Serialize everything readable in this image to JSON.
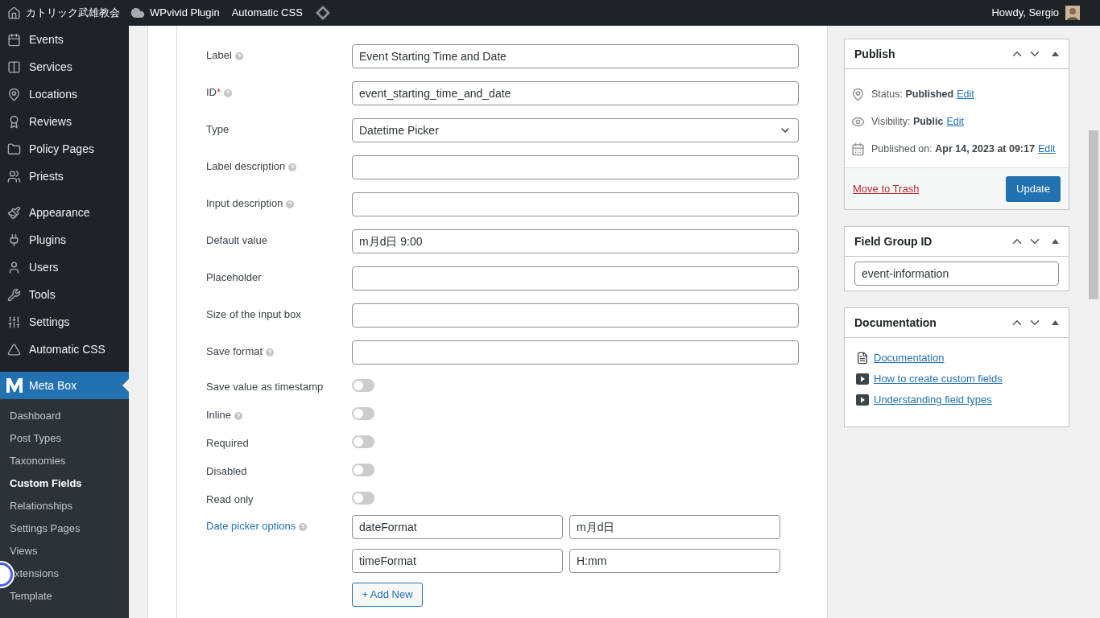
{
  "admin_bar": {
    "site_name": "カトリック武雄教会",
    "items": [
      "WPvivid Plugin",
      "Automatic CSS"
    ],
    "greeting": "Howdy, Sergio"
  },
  "sidebar": {
    "items": [
      {
        "label": "Events",
        "selected": false
      },
      {
        "label": "Services",
        "selected": false
      },
      {
        "label": "Locations",
        "selected": false
      },
      {
        "label": "Reviews",
        "selected": false
      },
      {
        "label": "Policy Pages",
        "selected": false
      },
      {
        "label": "Priests",
        "selected": false
      },
      {
        "label": "Appearance",
        "selected": false
      },
      {
        "label": "Plugins",
        "selected": false
      },
      {
        "label": "Users",
        "selected": false
      },
      {
        "label": "Tools",
        "selected": false
      },
      {
        "label": "Settings",
        "selected": false
      },
      {
        "label": "Automatic CSS",
        "selected": false
      },
      {
        "label": "Meta Box",
        "selected": true
      }
    ],
    "submenu": [
      {
        "label": "Dashboard",
        "selected": false
      },
      {
        "label": "Post Types",
        "selected": false
      },
      {
        "label": "Taxonomies",
        "selected": false
      },
      {
        "label": "Custom Fields",
        "selected": true
      },
      {
        "label": "Relationships",
        "selected": false
      },
      {
        "label": "Settings Pages",
        "selected": false
      },
      {
        "label": "Views",
        "selected": false
      },
      {
        "label": "xtensions",
        "selected": false
      },
      {
        "label": "Template",
        "selected": false
      }
    ]
  },
  "fields": [
    {
      "kind": "text",
      "label": "Label",
      "help": true,
      "value": "Event Starting Time and Date"
    },
    {
      "kind": "text",
      "label": "ID",
      "required_mark": "*",
      "help": true,
      "value": "event_starting_time_and_date"
    },
    {
      "kind": "select",
      "label": "Type",
      "help": false,
      "value": "Datetime Picker"
    },
    {
      "kind": "text",
      "label": "Label description",
      "help": true
    },
    {
      "kind": "text",
      "label": "Input description",
      "help": true
    },
    {
      "kind": "text",
      "label": "Default value",
      "help": false,
      "value": "m月d日 9:00"
    },
    {
      "kind": "text",
      "label": "Placeholder",
      "help": false
    },
    {
      "kind": "text",
      "label": "Size of the input box",
      "help": false
    },
    {
      "kind": "text",
      "label": "Save format",
      "help": true
    },
    {
      "kind": "toggle",
      "label": "Save value as timestamp",
      "help": false,
      "on": false
    },
    {
      "kind": "toggle",
      "label": "Inline",
      "help": true,
      "on": false
    },
    {
      "kind": "toggle",
      "label": "Required",
      "help": false,
      "on": false
    },
    {
      "kind": "toggle",
      "label": "Disabled",
      "help": false,
      "on": false
    },
    {
      "kind": "toggle",
      "label": "Read only",
      "help": false,
      "on": false
    },
    {
      "kind": "options",
      "label": "Date picker options",
      "help": true,
      "pairs": [
        {
          "key": "dateFormat",
          "value": "m月d日"
        },
        {
          "key": "timeFormat",
          "value": "H:mm"
        }
      ],
      "add_button": "+ Add New"
    }
  ],
  "publish": {
    "title": "Publish",
    "rows": [
      {
        "label": "Status:",
        "value": "Published",
        "link": "Edit"
      },
      {
        "label": "Visibility:",
        "value": "Public",
        "link": "Edit"
      },
      {
        "label": "Published on:",
        "value": "Apr 14, 2023 at 09:17",
        "link": "Edit"
      }
    ],
    "trash": "Move to Trash",
    "update": "Update"
  },
  "field_group": {
    "title": "Field Group ID",
    "value": "event-information"
  },
  "documentation": {
    "title": "Documentation",
    "links": [
      "Documentation",
      "How to create custom fields",
      "Understanding field types"
    ]
  }
}
